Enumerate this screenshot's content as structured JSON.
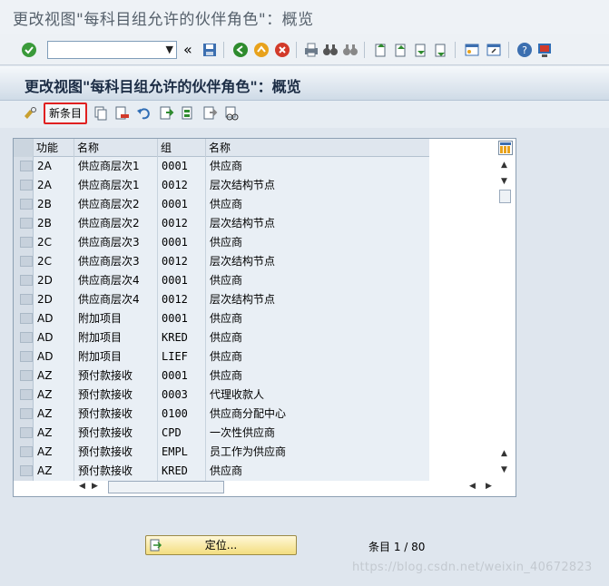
{
  "window_title": "更改视图\"每科目组允许的伙伴角色\"：概览",
  "screen_title": "更改视图\"每科目组允许的伙伴角色\"：概览",
  "command_field": {
    "value": ""
  },
  "app_toolbar": {
    "new_entries_label": "新条目"
  },
  "table": {
    "columns": [
      "功能",
      "名称",
      "组",
      "名称"
    ],
    "rows": [
      {
        "func": "2A",
        "name": "供应商层次1",
        "group": "0001",
        "group_name": "供应商"
      },
      {
        "func": "2A",
        "name": "供应商层次1",
        "group": "0012",
        "group_name": "层次结构节点"
      },
      {
        "func": "2B",
        "name": "供应商层次2",
        "group": "0001",
        "group_name": "供应商"
      },
      {
        "func": "2B",
        "name": "供应商层次2",
        "group": "0012",
        "group_name": "层次结构节点"
      },
      {
        "func": "2C",
        "name": "供应商层次3",
        "group": "0001",
        "group_name": "供应商"
      },
      {
        "func": "2C",
        "name": "供应商层次3",
        "group": "0012",
        "group_name": "层次结构节点"
      },
      {
        "func": "2D",
        "name": "供应商层次4",
        "group": "0001",
        "group_name": "供应商"
      },
      {
        "func": "2D",
        "name": "供应商层次4",
        "group": "0012",
        "group_name": "层次结构节点"
      },
      {
        "func": "AD",
        "name": "附加项目",
        "group": "0001",
        "group_name": "供应商"
      },
      {
        "func": "AD",
        "name": "附加项目",
        "group": "KRED",
        "group_name": "供应商"
      },
      {
        "func": "AD",
        "name": "附加项目",
        "group": "LIEF",
        "group_name": "供应商"
      },
      {
        "func": "AZ",
        "name": "预付款接收",
        "group": "0001",
        "group_name": "供应商"
      },
      {
        "func": "AZ",
        "name": "预付款接收",
        "group": "0003",
        "group_name": "代理收款人"
      },
      {
        "func": "AZ",
        "name": "预付款接收",
        "group": "0100",
        "group_name": "供应商分配中心"
      },
      {
        "func": "AZ",
        "name": "预付款接收",
        "group": "CPD",
        "group_name": "一次性供应商"
      },
      {
        "func": "AZ",
        "name": "预付款接收",
        "group": "EMPL",
        "group_name": "员工作为供应商"
      },
      {
        "func": "AZ",
        "name": "预付款接收",
        "group": "KRED",
        "group_name": "供应商"
      }
    ]
  },
  "position_button_label": "定位...",
  "entry_count": "条目 1 / 80",
  "watermark": "https://blog.csdn.net/weixin_40672823",
  "icons": [
    "enter-icon",
    "back-icon",
    "save-icon",
    "back-green-icon",
    "exit-icon",
    "cancel-icon",
    "print-icon",
    "find-icon",
    "find-next-icon",
    "first-page-icon",
    "prev-page-icon",
    "next-page-icon",
    "last-page-icon",
    "new-session-icon",
    "shortcut-icon",
    "help-icon",
    "customize-icon",
    "display-change-icon",
    "copy-as-icon",
    "delete-icon",
    "undo-icon",
    "select-all-icon",
    "select-block-icon",
    "deselect-all-icon",
    "glasses-icon",
    "column-settings-icon",
    "scroll-up-icon",
    "scroll-down-icon",
    "scroll-left-icon",
    "scroll-right-icon",
    "position-icon"
  ],
  "colors": {
    "accent_red": "#e02020",
    "title_bg": "#cfdbe7",
    "button_yellow": "#f3dd7f"
  }
}
